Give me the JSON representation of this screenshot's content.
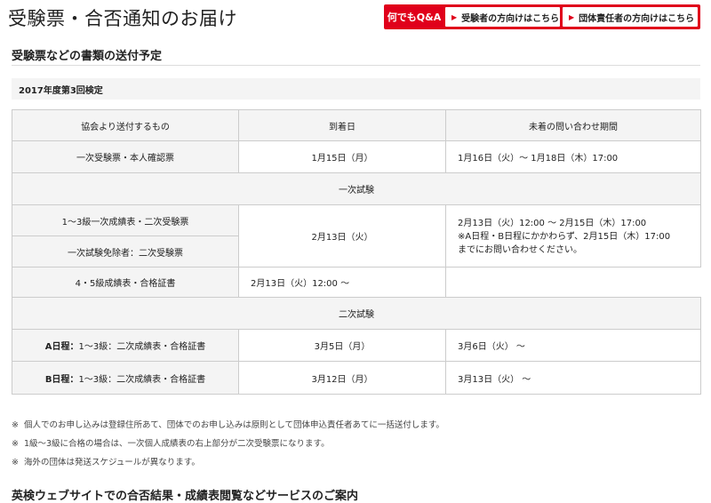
{
  "page_title": "受験票・合否通知のお届け",
  "header_nav": {
    "faq": "何でもQ&A",
    "links": [
      {
        "icon": "arrow-icon",
        "label": "受験者の方向けはこちら"
      },
      {
        "icon": "arrow-icon",
        "label": "団体責任者の方向けはこちら"
      }
    ]
  },
  "section1": {
    "title": "受験票などの書類の送付予定",
    "exam_title": "2017年度第3回検定",
    "table": {
      "headers": [
        "協会より送付するもの",
        "到着日",
        "未着の問い合わせ期間"
      ],
      "row1": {
        "item": "一次受験票・本人確認票",
        "arrival": "1月15日（月）",
        "inquiry": "1月16日（火）～ 1月18日（木）17:00"
      },
      "first_exam_label": "一次試験",
      "first_exam_rows": {
        "items": [
          "1～3級一次成績表・二次受験票",
          "一次試験免除者：二次受験票",
          "4・5級成績表・合格証書"
        ],
        "arrival": "2月13日（火）",
        "inquiry_lines": [
          "2月13日（火）12:00 ～ 2月15日（木）17:00",
          "※A日程・B日程にかかわらず、2月15日（木）17:00",
          "までにお問い合わせください。"
        ],
        "inquiry_grade45": "2月13日（火）12:00 ～"
      },
      "second_exam_label": "二次試験",
      "rowA": {
        "schedule": "A日程：",
        "item": "1～3級：二次成績表・合格証書",
        "arrival": "3月5日（月）",
        "inquiry": "3月6日（火） ～"
      },
      "rowB": {
        "schedule": "B日程：",
        "item": "1～3級：二次成績表・合格証書",
        "arrival": "3月12日（月）",
        "inquiry": "3月13日（火） ～"
      }
    }
  },
  "notes": [
    {
      "mark": "※",
      "text": "個人でのお申し込みは登録住所あて、団体でのお申し込みは原則として団体申込責任者あてに一括送付します。"
    },
    {
      "mark": "※",
      "text": "1級～3級に合格の場合は、一次個人成績表の右上部分が二次受験票になります。"
    },
    {
      "mark": "※",
      "text": "海外の団体は発送スケジュールが異なります。"
    }
  ],
  "section2": {
    "title": "英検ウェブサイトでの合否結果・成績表閲覧などサービスのご案内"
  },
  "colors": {
    "accent": "#e0001b",
    "table_header_bg": "#f4f4f4",
    "border": "#cccccc"
  }
}
